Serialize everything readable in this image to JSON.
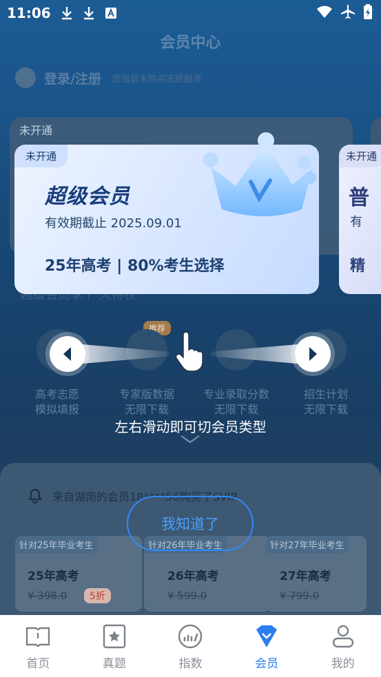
{
  "status_bar": {
    "time": "11:06"
  },
  "page": {
    "title": "会员中心"
  },
  "login": {
    "label": "登录/注册",
    "subtitle": "您当前未购买志愿服务"
  },
  "background_card": {
    "badge": "未开通",
    "benefits_text": "超级会员享个   大特权"
  },
  "features": [
    {
      "line1": "高考志愿",
      "line2": "模拟填报"
    },
    {
      "line1": "专家版数据",
      "line2": "无限下载"
    },
    {
      "line1": "专业录取分数",
      "line2": "无限下载"
    },
    {
      "line1": "招生计划",
      "line2": "无限下载"
    }
  ],
  "recommend_tag": "推荐",
  "notice": {
    "text": "来自湖南的会员18****56购买了SVIP"
  },
  "plans": [
    {
      "tag": "针对25年毕业考生",
      "name": "25年高考",
      "price": "¥ 398.0",
      "discount": "5折"
    },
    {
      "tag": "针对26年毕业考生",
      "name": "26年高考",
      "price": "¥ 599.0"
    },
    {
      "tag": "针对27年毕业考生",
      "name": "27年高考",
      "price": "¥ 799.0"
    }
  ],
  "carousel": {
    "current": {
      "badge": "未开通",
      "title": "超级会员",
      "validity": "有效期截止 2025.09.01",
      "meta": "25年高考  |  80%考生选择"
    },
    "next": {
      "badge": "未开通",
      "title": "普",
      "line2": "有",
      "line3": "精"
    }
  },
  "guide": {
    "hint": "左右滑动即可切会员类型",
    "confirm_label": "我知道了"
  },
  "tabs": [
    {
      "label": "首页",
      "icon": "book-icon"
    },
    {
      "label": "真题",
      "icon": "star-card-icon"
    },
    {
      "label": "指数",
      "icon": "gauge-icon"
    },
    {
      "label": "会员",
      "icon": "vip-shield-icon",
      "active": true
    },
    {
      "label": "我的",
      "icon": "user-icon"
    }
  ],
  "colors": {
    "accent": "#2b7df0",
    "overlay": "#0b2a47"
  }
}
